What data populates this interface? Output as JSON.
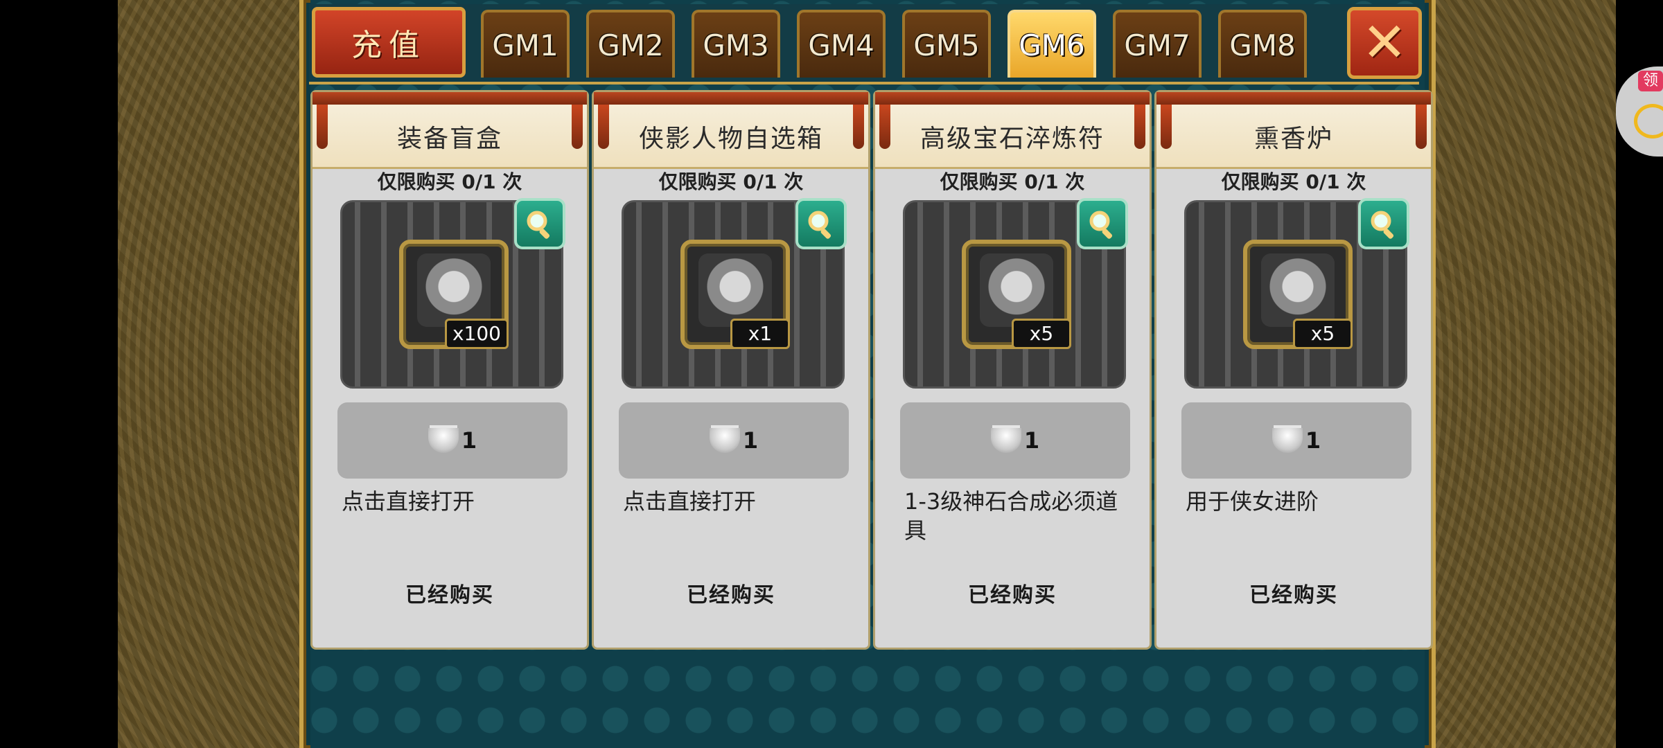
{
  "tabs": {
    "recharge_label": "充值",
    "items": [
      {
        "label": "GM1",
        "active": false
      },
      {
        "label": "GM2",
        "active": false
      },
      {
        "label": "GM3",
        "active": false
      },
      {
        "label": "GM4",
        "active": false
      },
      {
        "label": "GM5",
        "active": false
      },
      {
        "label": "GM6",
        "active": true
      },
      {
        "label": "GM7",
        "active": false
      },
      {
        "label": "GM8",
        "active": false
      }
    ],
    "close_label": "✕"
  },
  "cards": [
    {
      "title": "装备盲盒",
      "limit": "仅限购买 0/1 次",
      "qty": "x100",
      "price": "1",
      "desc": "点击直接打开",
      "status": "已经购买",
      "icon": "treasure-chest-icon"
    },
    {
      "title": "侠影人物自选箱",
      "limit": "仅限购买 0/1 次",
      "qty": "x1",
      "price": "1",
      "desc": "点击直接打开",
      "status": "已经购买",
      "icon": "treasure-chest-icon"
    },
    {
      "title": "高级宝石淬炼符",
      "limit": "仅限购买 0/1 次",
      "qty": "x5",
      "price": "1",
      "desc": "1-3级神石合成必须道具",
      "status": "已经购买",
      "icon": "scroll-charm-icon"
    },
    {
      "title": "熏香炉",
      "limit": "仅限购买 0/1 次",
      "qty": "x5",
      "price": "1",
      "desc": "用于侠女进阶",
      "status": "已经购买",
      "icon": "incense-burner-icon"
    }
  ],
  "side_widget": {
    "badge": "领"
  },
  "colors": {
    "active_tab": "#f2b93a",
    "panel_bg": "#0f3f4a",
    "card_bg": "#d7d7d7",
    "gold_border": "#c9a449"
  }
}
